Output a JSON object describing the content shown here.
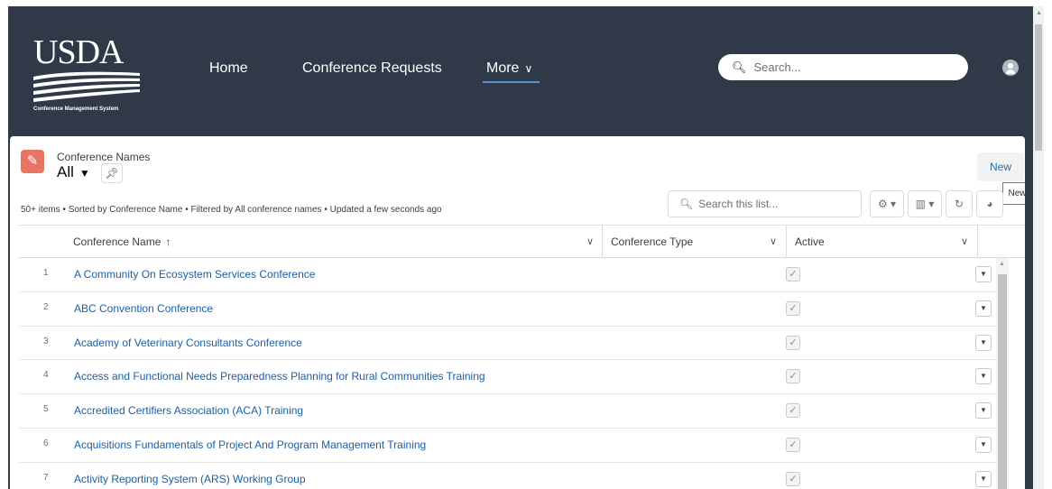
{
  "brand": {
    "logo_text": "USDA",
    "logo_subtitle": "Conference Management System"
  },
  "nav": {
    "home": "Home",
    "conference_requests": "Conference Requests",
    "more": "More",
    "more_chevron": "∨"
  },
  "global_search": {
    "icon": "search-icon",
    "placeholder": "Search..."
  },
  "list_view": {
    "object_label": "Conference Names",
    "view_name": "All",
    "view_caret": "▼",
    "meta": "50+ items • Sorted by Conference Name • Filtered by All conference names • Updated a few seconds ago",
    "new_button": "New",
    "tooltip": "New",
    "search_placeholder": "Search this list...",
    "toolbar": {
      "gear": "⚙ ▾",
      "columns": "▥ ▾",
      "refresh": "↻",
      "chart": "◕"
    }
  },
  "table": {
    "columns": [
      {
        "label": "Conference Name",
        "sort": "↑"
      },
      {
        "label": "Conference Type"
      },
      {
        "label": "Active"
      }
    ],
    "rows": [
      {
        "num": "1",
        "name": "A Community On Ecosystem Services Conference",
        "active": true
      },
      {
        "num": "2",
        "name": "ABC Convention Conference",
        "active": true
      },
      {
        "num": "3",
        "name": "Academy of Veterinary Consultants Conference",
        "active": true
      },
      {
        "num": "4",
        "name": "Access and Functional Needs Preparedness Planning for Rural Communities Training",
        "active": true
      },
      {
        "num": "5",
        "name": "Accredited Certifiers Association (ACA) Training",
        "active": true
      },
      {
        "num": "6",
        "name": "Acquisitions Fundamentals of Project And Program Management Training",
        "active": true
      },
      {
        "num": "7",
        "name": "Activity Reporting System (ARS) Working Group",
        "active": true
      }
    ]
  },
  "colors": {
    "header_bg": "#2f3947",
    "icon_bg": "#e87463",
    "link": "#1b5fa8",
    "nav_underline": "#5b8fd8"
  }
}
